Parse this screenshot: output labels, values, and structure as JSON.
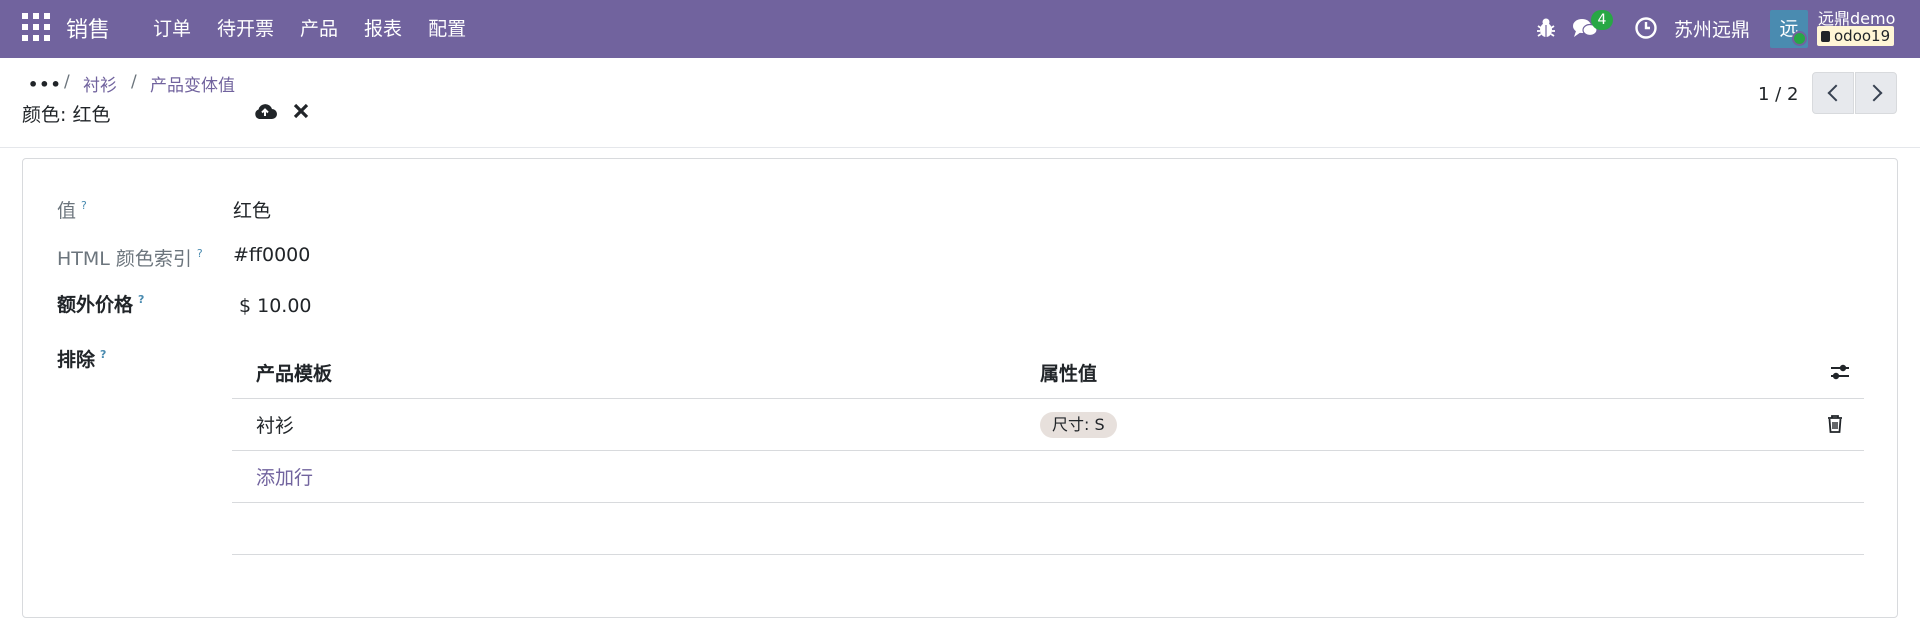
{
  "navbar": {
    "brand": "销售",
    "menu": [
      "订单",
      "待开票",
      "产品",
      "报表",
      "配置"
    ],
    "chat_count": "4",
    "company": "苏州远鼎",
    "avatar_letter": "远",
    "user_name": "远鼎demo",
    "database": "odoo19"
  },
  "breadcrumb": {
    "dots": "•••",
    "sep": "/",
    "items": [
      "衬衫",
      "产品变体值"
    ]
  },
  "record": {
    "title": "颜色: 红色"
  },
  "pager": {
    "value": "1 / 2"
  },
  "form": {
    "help_mark": "?",
    "value_label": "值",
    "value": "红色",
    "html_color_label": "HTML 颜色索引",
    "html_color": "#ff0000",
    "extra_price_label": "额外价格",
    "extra_price": "$ 10.00",
    "exclude_label": "排除"
  },
  "exclude_table": {
    "columns": [
      "产品模板",
      "属性值"
    ],
    "rows": [
      {
        "product_template": "衬衫",
        "attribute_value": "尺寸: S"
      }
    ],
    "add_line": "添加行"
  },
  "colors": {
    "navbar": "#71639e",
    "accent": "#71639e",
    "success": "#28a745",
    "tag_bg": "#e7e0dc"
  }
}
